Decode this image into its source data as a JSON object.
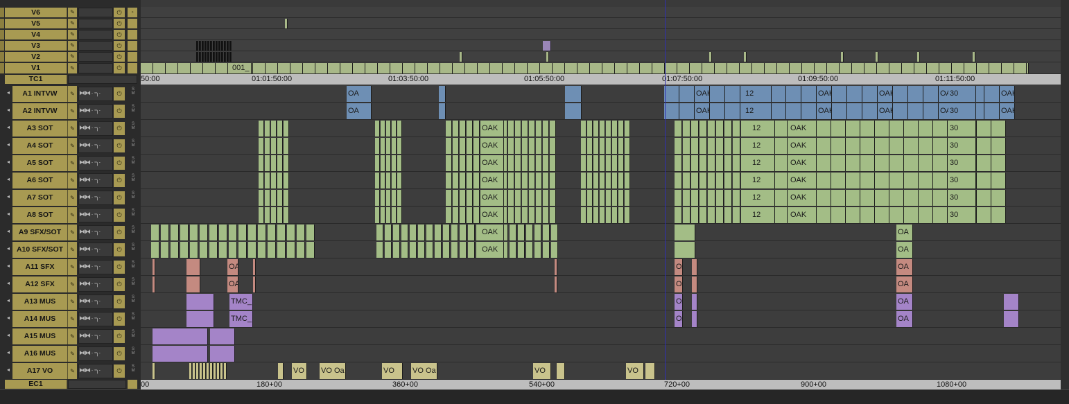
{
  "video_tracks": [
    {
      "id": "v6",
      "label": "V6"
    },
    {
      "id": "v5",
      "label": "V5"
    },
    {
      "id": "v4",
      "label": "V4"
    },
    {
      "id": "v3",
      "label": "V3"
    },
    {
      "id": "v2",
      "label": "V2"
    },
    {
      "id": "v1",
      "label": "V1"
    }
  ],
  "timecode_track": {
    "label": "TC1"
  },
  "audio_tracks": [
    {
      "id": "a1",
      "label": "A1 INTVW"
    },
    {
      "id": "a2",
      "label": "A2 INTVW"
    },
    {
      "id": "a3",
      "label": "A3 SOT"
    },
    {
      "id": "a4",
      "label": "A4 SOT"
    },
    {
      "id": "a5",
      "label": "A5 SOT"
    },
    {
      "id": "a6",
      "label": "A6 SOT"
    },
    {
      "id": "a7",
      "label": "A7 SOT"
    },
    {
      "id": "a8",
      "label": "A8 SOT"
    },
    {
      "id": "a9",
      "label": "A9 SFX/SOT"
    },
    {
      "id": "a10",
      "label": "A10 SFX/SOT"
    },
    {
      "id": "a11",
      "label": "A11 SFX"
    },
    {
      "id": "a12",
      "label": "A12 SFX"
    },
    {
      "id": "a13",
      "label": "A13 MUS"
    },
    {
      "id": "a14",
      "label": "A14 MUS"
    },
    {
      "id": "a15",
      "label": "A15 MUS"
    },
    {
      "id": "a16",
      "label": "A16 MUS"
    },
    {
      "id": "a17",
      "label": "A17 VO"
    }
  ],
  "edgecode_track": {
    "label": "EC1"
  },
  "ruler_top": {
    "ticks": [
      "50:00",
      "01:01:50:00",
      "01:03:50:00",
      "01:05:50:00",
      "01:07:50:00",
      "01:09:50:00",
      "01:11:50:00"
    ]
  },
  "ruler_bottom": {
    "ticks": [
      "00",
      "180+00",
      "360+00",
      "540+00",
      "720+00",
      "900+00",
      "1080+00"
    ]
  },
  "clip_labels": {
    "oak": "OAK",
    "vo": "VO",
    "vo_oa": "VO Oa",
    "tmc": "TMC_",
    "n001": "001_",
    "n12": "12",
    "n30": "30",
    "oa": "OA"
  },
  "colors": {
    "video": "#a8b888",
    "intvw": "#6e8fb4",
    "sot": "#a3bd86",
    "sfx": "#c48a80",
    "mus": "#a484c8",
    "vo": "#c9c38c",
    "track_gold": "#a89a52"
  }
}
